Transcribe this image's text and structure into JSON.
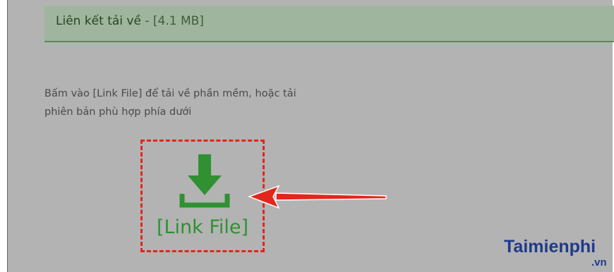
{
  "header": {
    "title": "Liên kết tải về",
    "separator": " - ",
    "size": "[4.1 MB]"
  },
  "description": {
    "line1": "Bấm vào [Link File] để tải về phần mềm, hoặc tải",
    "line2": "phiên bản phù hợp phía dưới"
  },
  "download": {
    "label": "[Link File]",
    "icon": "download-icon"
  },
  "watermark": {
    "text": "Taimienphi",
    "suffix": ".vn"
  },
  "colors": {
    "header_bg": "#a0b59d",
    "accent_green": "#2f9132",
    "highlight_red": "#e1261c",
    "background": "#b3b3b3"
  }
}
